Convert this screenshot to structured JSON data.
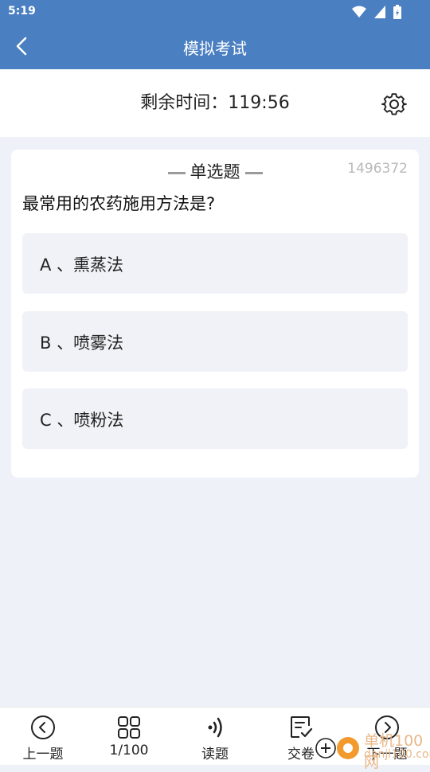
{
  "status_bar": {
    "time": "5:19"
  },
  "header": {
    "title": "模拟考试"
  },
  "timer": {
    "text": "剩余时间：119:56"
  },
  "question": {
    "type": "单选题",
    "id": "1496372",
    "text": "最常用的农药施用方法是?",
    "options": [
      {
        "label": "A 、熏蒸法"
      },
      {
        "label": "B 、喷雾法"
      },
      {
        "label": "C 、喷粉法"
      }
    ]
  },
  "bottom_nav": {
    "items": [
      {
        "label": "上一题",
        "icon": "chevron-left-circle-icon"
      },
      {
        "label": "1/100",
        "icon": "grid-icon"
      },
      {
        "label": "读题",
        "icon": "sound-icon"
      },
      {
        "label": "交卷",
        "icon": "submit-icon"
      },
      {
        "label": "下一题",
        "icon": "chevron-right-circle-icon"
      }
    ]
  },
  "watermark": {
    "line1": "单机100网",
    "line2": "danji100.com"
  },
  "colors": {
    "primary": "#4a7fc2",
    "background": "#eff1f8",
    "option_bg": "#f1f2f7"
  }
}
